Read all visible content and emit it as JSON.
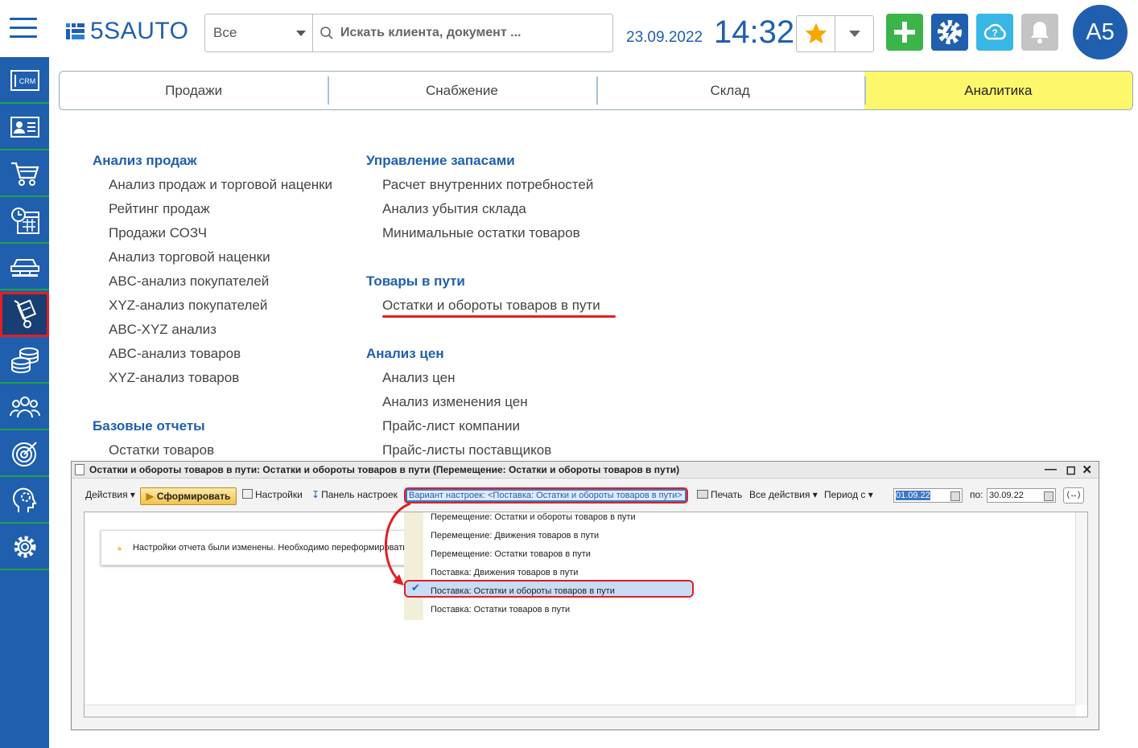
{
  "header": {
    "logo_text": "5SAUTO",
    "search_scope": "Все",
    "search_placeholder": "Искать клиента, документ ...",
    "date": "23.09.2022",
    "time": "14:32",
    "avatar_initials": "А5"
  },
  "sidebar": {
    "items": [
      {
        "icon": "crm-icon",
        "label": "CRM"
      },
      {
        "icon": "contacts-card-icon"
      },
      {
        "icon": "shopping-cart-icon"
      },
      {
        "icon": "calendar-clock-icon"
      },
      {
        "icon": "car-lift-icon"
      },
      {
        "icon": "hand-truck-icon",
        "active": true
      },
      {
        "icon": "coins-stack-icon"
      },
      {
        "icon": "team-icon"
      },
      {
        "icon": "target-icon"
      },
      {
        "icon": "head-gear-icon"
      },
      {
        "icon": "settings-gear-icon"
      }
    ]
  },
  "tabs": [
    {
      "label": "Продажи"
    },
    {
      "label": "Снабжение"
    },
    {
      "label": "Склад"
    },
    {
      "label": "Аналитика",
      "active": true
    }
  ],
  "menu": {
    "col1": {
      "sales_title": "Анализ продаж",
      "sales_items": [
        "Анализ продаж и торговой наценки",
        "Рейтинг продаж",
        "Продажи СОЗЧ",
        "Анализ торговой наценки",
        "ABC-анализ покупателей",
        "XYZ-анализ покупателей",
        "ABC-XYZ анализ",
        "ABC-анализ товаров",
        "XYZ-анализ товаров"
      ],
      "base_title": "Базовые отчеты",
      "base_items": [
        "Остатки товаров"
      ]
    },
    "col2": {
      "stock_title": "Управление запасами",
      "stock_items": [
        "Расчет внутренних потребностей",
        "Анализ убытия склада",
        "Минимальные остатки товаров"
      ],
      "transit_title": "Товары в пути",
      "transit_items": [
        "Остатки и обороты товаров в пути"
      ],
      "prices_title": "Анализ цен",
      "prices_items": [
        "Анализ цен",
        "Анализ изменения цен",
        "Прайс-лист компании",
        "Прайс-листы поставщиков"
      ]
    }
  },
  "report": {
    "title": "Остатки и обороты товаров в пути: Остатки и обороты товаров в пути (Перемещение:  Остатки и обороты товаров в пути)",
    "toolbar": {
      "actions": "Действия",
      "generate": "Сформировать",
      "settings": "Настройки",
      "panel": "Панель настроек",
      "variant": "Вариант настроек: <Поставка: Остатки и обороты товаров в пути>",
      "print": "Печать",
      "all_actions": "Все действия",
      "period": "Период с",
      "date_from": "01.09.22",
      "to_label": "по:",
      "date_to": "30.09.22"
    },
    "warning": "Настройки отчета были изменены. Необходимо переформировать",
    "variants": [
      "Перемещение:  Остатки и обороты товаров в пути",
      "Перемещение: Движения товаров в пути",
      "Перемещение: Остатки товаров в пути",
      "Поставка: Движения товаров в пути",
      "Поставка: Остатки и обороты товаров в пути",
      "Поставка: Остатки товаров в пути"
    ],
    "selected_variant_index": 4
  },
  "colors": {
    "brand_blue": "#1f5fae",
    "active_tab": "#fdf76c",
    "highlight_red": "#e31e24",
    "add_green": "#3bb54a"
  }
}
